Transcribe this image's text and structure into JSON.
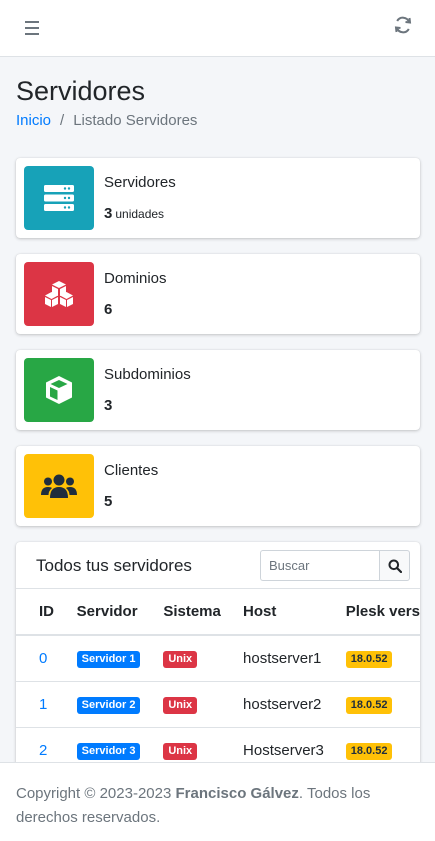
{
  "topbar": {
    "menu_icon": "bars-icon",
    "refresh_icon": "sync-icon"
  },
  "page": {
    "title": "Servidores",
    "breadcrumb": {
      "home": "Inicio",
      "separator": "/",
      "current": "Listado Servidores"
    }
  },
  "info_boxes": [
    {
      "label": "Servidores",
      "value": "3",
      "unit": "unidades",
      "icon": "server-icon",
      "color": "#17a2b8"
    },
    {
      "label": "Dominios",
      "value": "6",
      "icon": "cubes-icon",
      "color": "#dc3545"
    },
    {
      "label": "Subdominios",
      "value": "3",
      "icon": "cube-icon",
      "color": "#28a745"
    },
    {
      "label": "Clientes",
      "value": "5",
      "icon": "users-icon",
      "color": "#ffc107"
    }
  ],
  "servers_card": {
    "title": "Todos tus servidores",
    "search_placeholder": "Buscar",
    "columns": [
      "ID",
      "Servidor",
      "Sistema",
      "Host",
      "Plesk vers"
    ],
    "rows": [
      {
        "id": "0",
        "server": "Servidor 1",
        "system": "Unix",
        "host": "hostserver1",
        "plesk": "18.0.52"
      },
      {
        "id": "1",
        "server": "Servidor 2",
        "system": "Unix",
        "host": "hostserver2",
        "plesk": "18.0.52"
      },
      {
        "id": "2",
        "server": "Servidor 3",
        "system": "Unix",
        "host": "Hostserver3",
        "plesk": "18.0.52"
      }
    ]
  },
  "footer": {
    "copyright": "Copyright © 2023-2023 ",
    "author": "Francisco Gálvez",
    "rights": ". Todos los derechos reservados."
  },
  "colors": {
    "primary": "#007bff",
    "info": "#17a2b8",
    "danger": "#dc3545",
    "success": "#28a745",
    "warning": "#ffc107"
  }
}
